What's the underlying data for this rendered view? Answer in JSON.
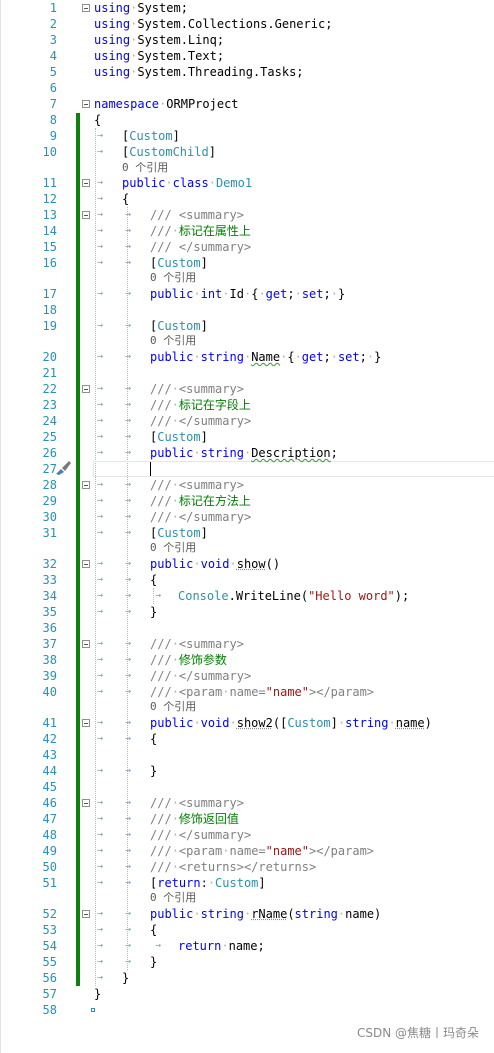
{
  "editor": {
    "lines": {
      "l1": {
        "num": "1",
        "text": "using System;"
      },
      "l2": {
        "num": "2",
        "text": "using System.Collections.Generic;"
      },
      "l3": {
        "num": "3",
        "text": "using System.Linq;"
      },
      "l4": {
        "num": "4",
        "text": "using System.Text;"
      },
      "l5": {
        "num": "5",
        "text": "using System.Threading.Tasks;"
      },
      "l6": {
        "num": "6"
      },
      "l7": {
        "num": "7"
      },
      "l8": {
        "num": "8"
      },
      "l9": {
        "num": "9"
      },
      "l10": {
        "num": "10"
      },
      "l11": {
        "num": "11"
      },
      "l12": {
        "num": "12"
      },
      "l13": {
        "num": "13"
      },
      "l14": {
        "num": "14"
      },
      "l15": {
        "num": "15"
      },
      "l16": {
        "num": "16"
      },
      "l17": {
        "num": "17"
      },
      "l18": {
        "num": "18"
      },
      "l19": {
        "num": "19"
      },
      "l20": {
        "num": "20"
      },
      "l21": {
        "num": "21"
      },
      "l22": {
        "num": "22"
      },
      "l23": {
        "num": "23"
      },
      "l24": {
        "num": "24"
      },
      "l25": {
        "num": "25"
      },
      "l26": {
        "num": "26"
      },
      "l27": {
        "num": "27"
      },
      "l28": {
        "num": "28"
      },
      "l29": {
        "num": "29"
      },
      "l30": {
        "num": "30"
      },
      "l31": {
        "num": "31"
      },
      "l32": {
        "num": "32"
      },
      "l33": {
        "num": "33"
      },
      "l34": {
        "num": "34"
      },
      "l35": {
        "num": "35"
      },
      "l36": {
        "num": "36"
      },
      "l37": {
        "num": "37"
      },
      "l38": {
        "num": "38"
      },
      "l39": {
        "num": "39"
      },
      "l40": {
        "num": "40"
      },
      "l41": {
        "num": "41"
      },
      "l42": {
        "num": "42"
      },
      "l43": {
        "num": "43"
      },
      "l44": {
        "num": "44"
      },
      "l45": {
        "num": "45"
      },
      "l46": {
        "num": "46"
      },
      "l47": {
        "num": "47"
      },
      "l48": {
        "num": "48"
      },
      "l49": {
        "num": "49"
      },
      "l50": {
        "num": "50"
      },
      "l51": {
        "num": "51"
      },
      "l52": {
        "num": "52"
      },
      "l53": {
        "num": "53"
      },
      "l54": {
        "num": "54"
      },
      "l55": {
        "num": "55"
      },
      "l56": {
        "num": "56"
      },
      "l57": {
        "num": "57"
      },
      "l58": {
        "num": "58"
      }
    },
    "codelens": {
      "refs_0": "0 个引用"
    },
    "tokens": {
      "using": "using",
      "namespace": "namespace",
      "ns_name": "ORMProject",
      "attr_custom": "Custom",
      "attr_custom_child": "CustomChild",
      "kw_public": "public",
      "kw_class": "class",
      "class_name": "Demo1",
      "xml_summary_open": "/// <summary>",
      "xml_summary_close": "/// </summary>",
      "xml_returns": "/// <returns></returns>",
      "comment_prop": "标记在属性上",
      "comment_field": "标记在字段上",
      "comment_method": "标记在方法上",
      "comment_param": "修饰参数",
      "comment_return": "修饰返回值",
      "kw_int": "int",
      "kw_string": "string",
      "kw_void": "void",
      "kw_get": "get",
      "kw_set": "set",
      "kw_return": "return",
      "prop_id": "Id",
      "prop_name": "Name",
      "field_desc": "Description",
      "method_show": "show",
      "method_show2": "show2",
      "method_rname": "rName",
      "param_name": "name",
      "console": "Console",
      "writeline": "WriteLine",
      "hello": "\"Hello word\"",
      "param_attr_name": "\"name\"",
      "return_target": "return:"
    }
  },
  "watermark": "CSDN @焦糖丨玛奇朵",
  "colors": {
    "keyword": "#0000ff",
    "type": "#2b91af",
    "comment": "#008000",
    "string": "#a31515",
    "changebar": "#108010"
  }
}
